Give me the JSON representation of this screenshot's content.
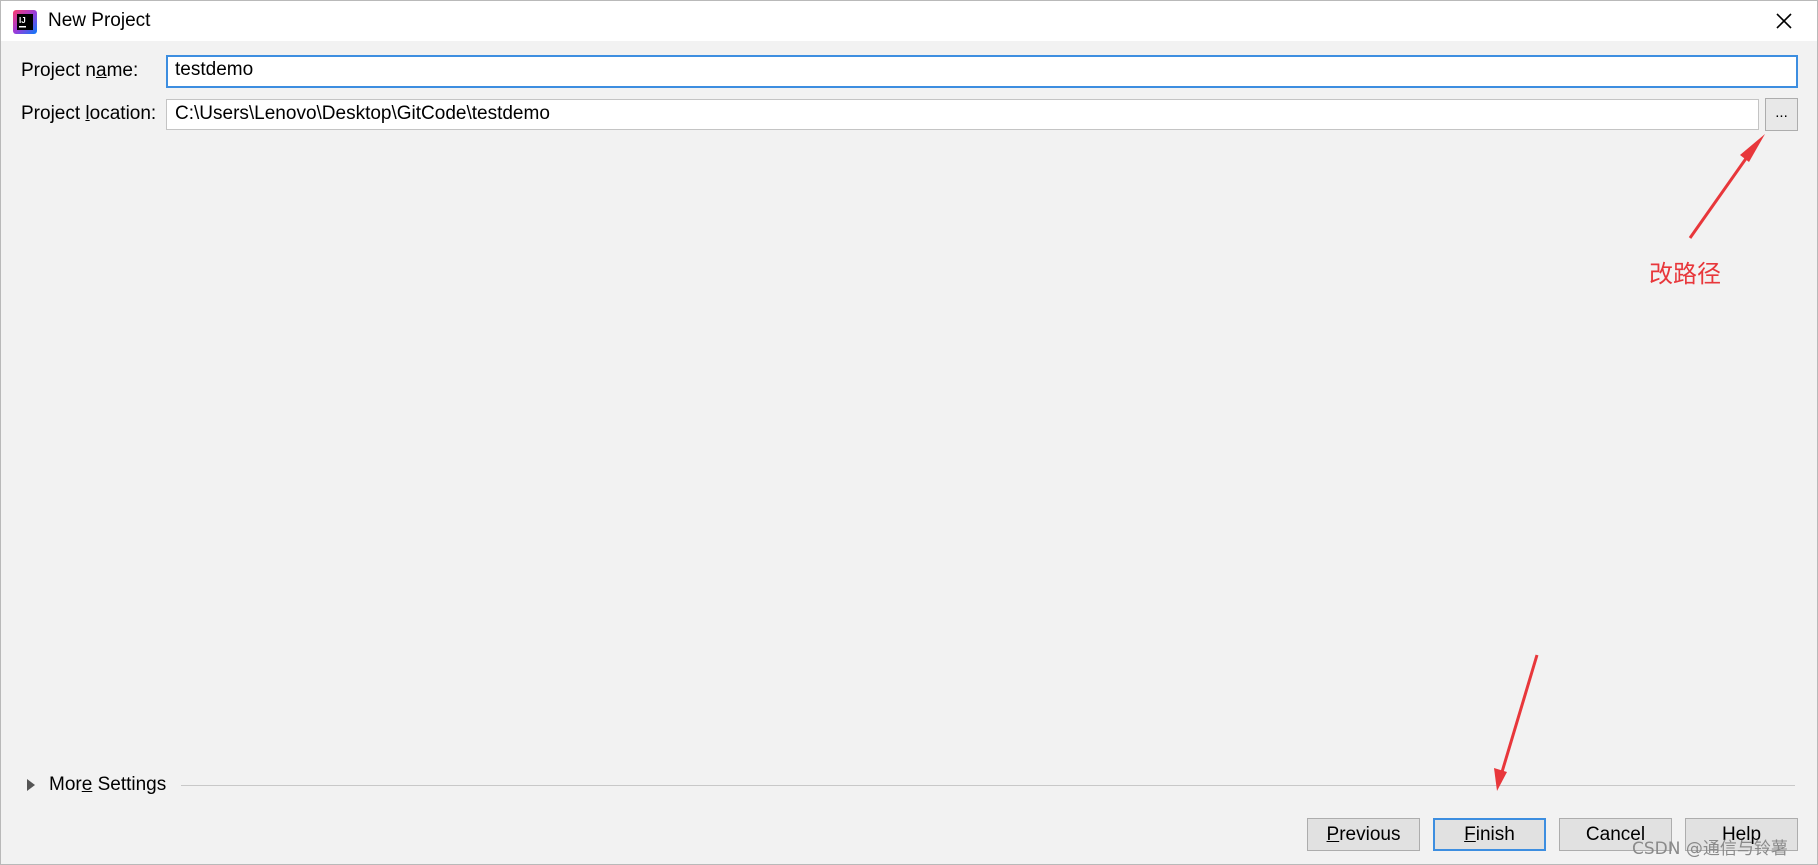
{
  "window": {
    "title": "New Project",
    "close_glyph": "✕"
  },
  "form": {
    "name_label_pre": "Project n",
    "name_label_mn": "a",
    "name_label_post": "me:",
    "name_value": "testdemo",
    "location_label_pre": "Project ",
    "location_label_mn": "l",
    "location_label_post": "ocation:",
    "location_value": "C:\\Users\\Lenovo\\Desktop\\GitCode\\testdemo",
    "browse_label": "..."
  },
  "more_settings": {
    "label_pre": "Mor",
    "label_mn": "e",
    "label_post": " Settings"
  },
  "buttons": {
    "previous_mn": "P",
    "previous_rest": "revious",
    "finish_mn": "F",
    "finish_rest": "inish",
    "cancel": "Cancel",
    "help": "Help"
  },
  "annotation": {
    "text": "改路径",
    "color": "#e8373b"
  },
  "watermark": "CSDN @通信与铃薯",
  "colors": {
    "focus_blue": "#3d8ee0",
    "background": "#f2f2f2"
  },
  "icons": {
    "app": "intellij-idea-icon",
    "close": "close-icon",
    "expand": "triangle-right-icon"
  }
}
